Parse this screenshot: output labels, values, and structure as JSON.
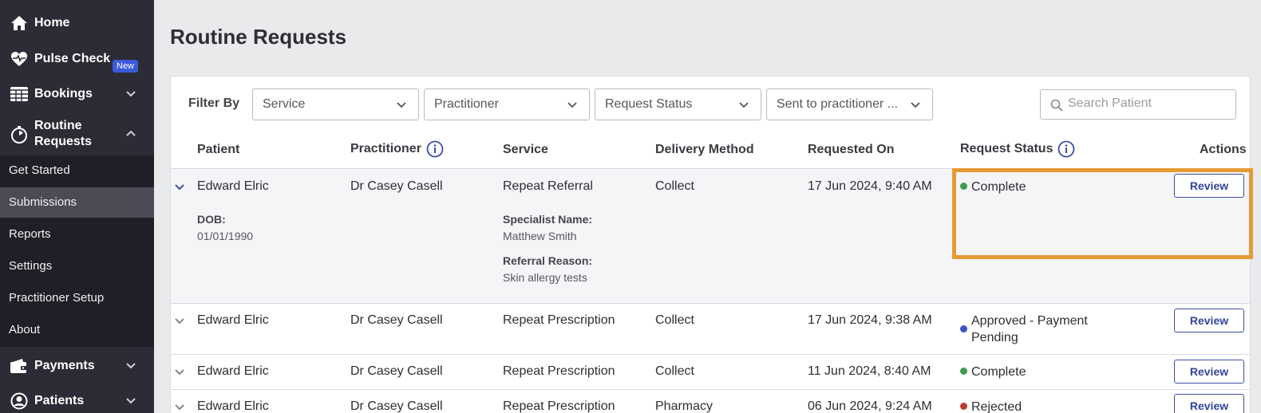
{
  "sidebar": {
    "home": "Home",
    "pulse_check": "Pulse Check",
    "pulse_badge": "New",
    "bookings": "Bookings",
    "routine_requests_line1": "Routine",
    "routine_requests_line2": "Requests",
    "sub_items": [
      "Get Started",
      "Submissions",
      "Reports",
      "Settings",
      "Practitioner Setup",
      "About"
    ],
    "active_sub_item": "Submissions",
    "payments": "Payments",
    "patients": "Patients"
  },
  "page": {
    "title": "Routine Requests"
  },
  "filters": {
    "label": "Filter By",
    "service": "Service",
    "practitioner": "Practitioner",
    "request_status": "Request Status",
    "sent_to": "Sent to practitioner ...",
    "search_placeholder": "Search Patient"
  },
  "table": {
    "headers": {
      "patient": "Patient",
      "practitioner": "Practitioner",
      "service": "Service",
      "delivery": "Delivery Method",
      "requested_on": "Requested On",
      "status": "Request Status",
      "actions": "Actions"
    },
    "rows": [
      {
        "patient": "Edward Elric",
        "practitioner": "Dr Casey Casell",
        "service": "Repeat Referral",
        "delivery": "Collect",
        "requested_on": "17 Jun 2024, 9:40 AM",
        "status": "Complete",
        "status_color": "#3f9b4f",
        "action": "Review",
        "details": {
          "dob_label": "DOB:",
          "dob": "01/01/1990",
          "specialist_label": "Specialist Name:",
          "specialist": "Matthew Smith",
          "reason_label": "Referral Reason:",
          "reason": "Skin allergy tests"
        }
      },
      {
        "patient": "Edward Elric",
        "practitioner": "Dr Casey Casell",
        "service": "Repeat Prescription",
        "delivery": "Collect",
        "requested_on": "17 Jun 2024, 9:38 AM",
        "status_line1": "Approved - Payment",
        "status_line2": "Pending",
        "status_color": "#3b4fc9",
        "action": "Review"
      },
      {
        "patient": "Edward Elric",
        "practitioner": "Dr Casey Casell",
        "service": "Repeat Prescription",
        "delivery": "Collect",
        "requested_on": "11 Jun 2024, 8:40 AM",
        "status": "Complete",
        "status_color": "#3f9b4f",
        "action": "Review"
      },
      {
        "patient": "Edward Elric",
        "practitioner": "Dr Casey Casell",
        "service": "Repeat Prescription",
        "delivery": "Pharmacy",
        "requested_on": "06 Jun 2024, 9:24 AM",
        "status": "Rejected",
        "status_color": "#c0392b",
        "action": "Review"
      }
    ]
  },
  "colors": {
    "accent": "#3b4fa0",
    "highlight": "#e69a33",
    "sidebar_bg": "#2b2c35"
  }
}
